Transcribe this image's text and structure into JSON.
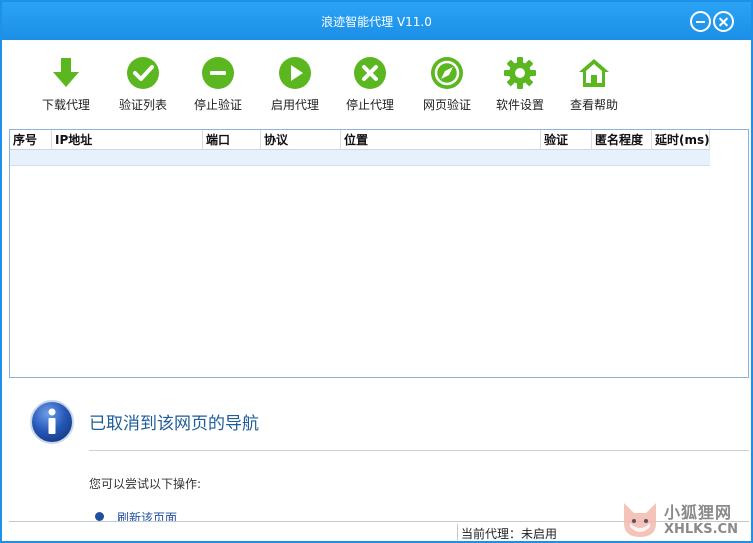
{
  "window": {
    "title": "浪迹智能代理 V11.0"
  },
  "colors": {
    "titlebar": "#1B8FE6",
    "icon_green": "#5BB71F",
    "link": "#1F4F9E",
    "heading": "#1F5C99"
  },
  "toolbar": {
    "items": [
      {
        "label": "下载代理",
        "icon": "download-arrow-icon"
      },
      {
        "label": "验证列表",
        "icon": "check-circle-icon"
      },
      {
        "label": "停止验证",
        "icon": "minus-circle-icon"
      },
      {
        "label": "启用代理",
        "icon": "play-circle-icon"
      },
      {
        "label": "停止代理",
        "icon": "close-circle-icon"
      },
      {
        "label": "网页验证",
        "icon": "compass-icon"
      },
      {
        "label": "软件设置",
        "icon": "gear-icon"
      },
      {
        "label": "查看帮助",
        "icon": "home-icon"
      }
    ]
  },
  "grid": {
    "columns": [
      "序号",
      "IP地址",
      "端口",
      "协议",
      "位置",
      "验证",
      "匿名程度",
      "延时(ms)"
    ]
  },
  "nav": {
    "heading": "已取消到该网页的导航",
    "subtext": "您可以尝试以下操作:",
    "link": "刷新该页面"
  },
  "status": {
    "text": "当前代理：未启用"
  },
  "watermark": {
    "cn": "小狐狸网",
    "en": "XHLKS.CN"
  }
}
